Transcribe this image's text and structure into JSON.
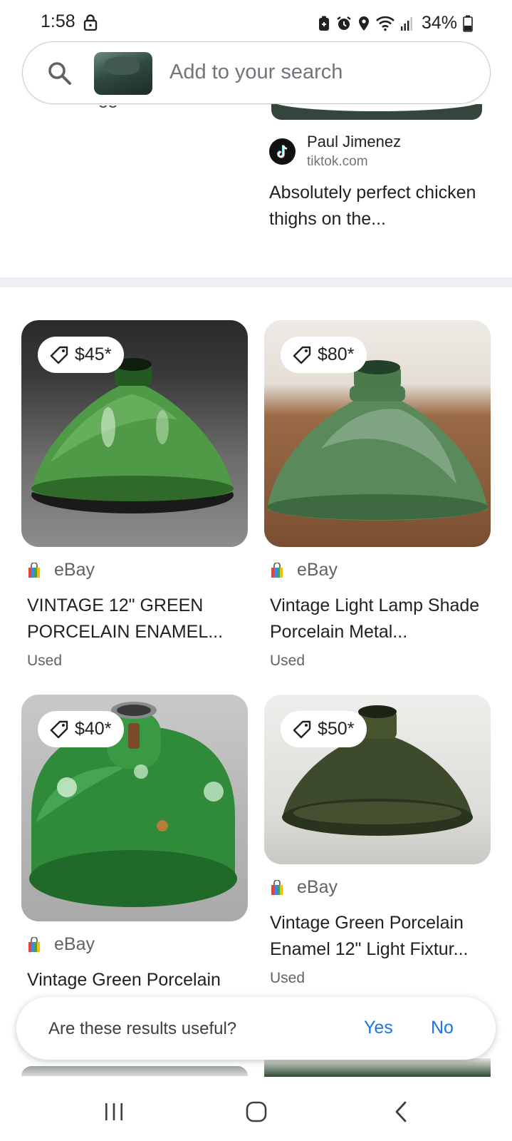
{
  "status_bar": {
    "time": "1:58",
    "battery": "34%",
    "icons": [
      "lock-icon",
      "battery-saver-icon",
      "alarm-icon",
      "location-icon",
      "wifi-icon",
      "signal-icon",
      "battery-icon"
    ]
  },
  "search": {
    "placeholder": "Add to your search",
    "image_chip": "search-image-thumbnail"
  },
  "previous_result": {
    "author": "Paul Jimenez",
    "domain": "tiktok.com",
    "title": "Absolutely perfect chicken thighs on the..."
  },
  "products": [
    {
      "price": "$45*",
      "source": "eBay",
      "title": "VINTAGE 12\" GREEN PORCELAIN ENAMEL...",
      "condition": "Used"
    },
    {
      "price": "$80*",
      "source": "eBay",
      "title": "Vintage Light Lamp Shade Porcelain Metal...",
      "condition": "Used"
    },
    {
      "price": "$40*",
      "source": "eBay",
      "title": "Vintage Green Porcelain",
      "condition": ""
    },
    {
      "price": "$50*",
      "source": "eBay",
      "title": "Vintage Green Porcelain Enamel 12\" Light Fixtur...",
      "condition": "Used"
    }
  ],
  "feedback": {
    "question": "Are these results useful?",
    "yes": "Yes",
    "no": "No"
  },
  "nav": {
    "recent": "recent-apps-icon",
    "home": "home-icon",
    "back": "back-icon"
  },
  "colors": {
    "link": "#1a73e8",
    "text": "#202124",
    "secondary": "#5f6368",
    "divider": "#eef0f3"
  }
}
